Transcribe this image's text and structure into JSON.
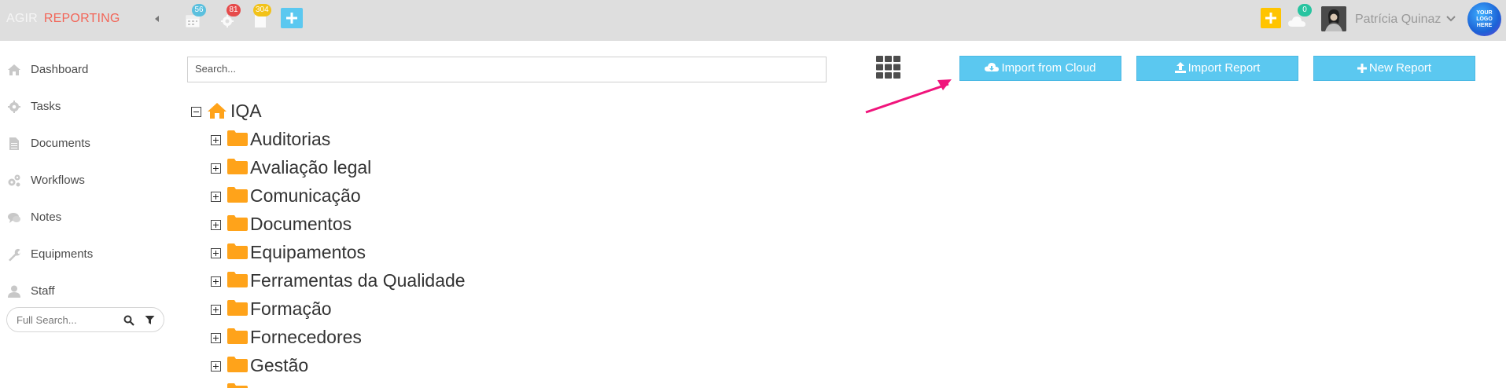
{
  "header": {
    "brand_part1": "AGIR",
    "brand_part2": "REPORTING",
    "badges": {
      "calendar": "56",
      "settings": "81",
      "clipboard": "304",
      "cloud": "0"
    },
    "user_name": "Patrícia Quinaz",
    "logo_text": "YOUR LOGO HERE"
  },
  "sidebar": {
    "items": [
      {
        "label": "Dashboard",
        "icon": "home-icon"
      },
      {
        "label": "Tasks",
        "icon": "gear-icon"
      },
      {
        "label": "Documents",
        "icon": "document-icon"
      },
      {
        "label": "Workflows",
        "icon": "gears-icon"
      },
      {
        "label": "Notes",
        "icon": "chat-icon"
      },
      {
        "label": "Equipments",
        "icon": "wrench-icon"
      },
      {
        "label": "Staff",
        "icon": "user-icon"
      }
    ],
    "full_search_placeholder": "Full Search..."
  },
  "main": {
    "search_placeholder": "Search...",
    "buttons": {
      "import_cloud": "Import from Cloud",
      "import_report": "Import Report",
      "new_report": "New Report"
    },
    "tree": {
      "root": "IQA",
      "folders": [
        "Auditorias",
        "Avaliação legal",
        "Comunicação",
        "Documentos",
        "Equipamentos",
        "Ferramentas da Qualidade",
        "Formação",
        "Fornecedores",
        "Gestão"
      ]
    }
  },
  "colors": {
    "topbar_bg": "#dedede",
    "accent_blue": "#5bc8f0",
    "folder_orange": "#ffa31a",
    "brand_red": "#f26659",
    "arrow_pink": "#f0157c",
    "plus_yellow": "#ffc400"
  }
}
